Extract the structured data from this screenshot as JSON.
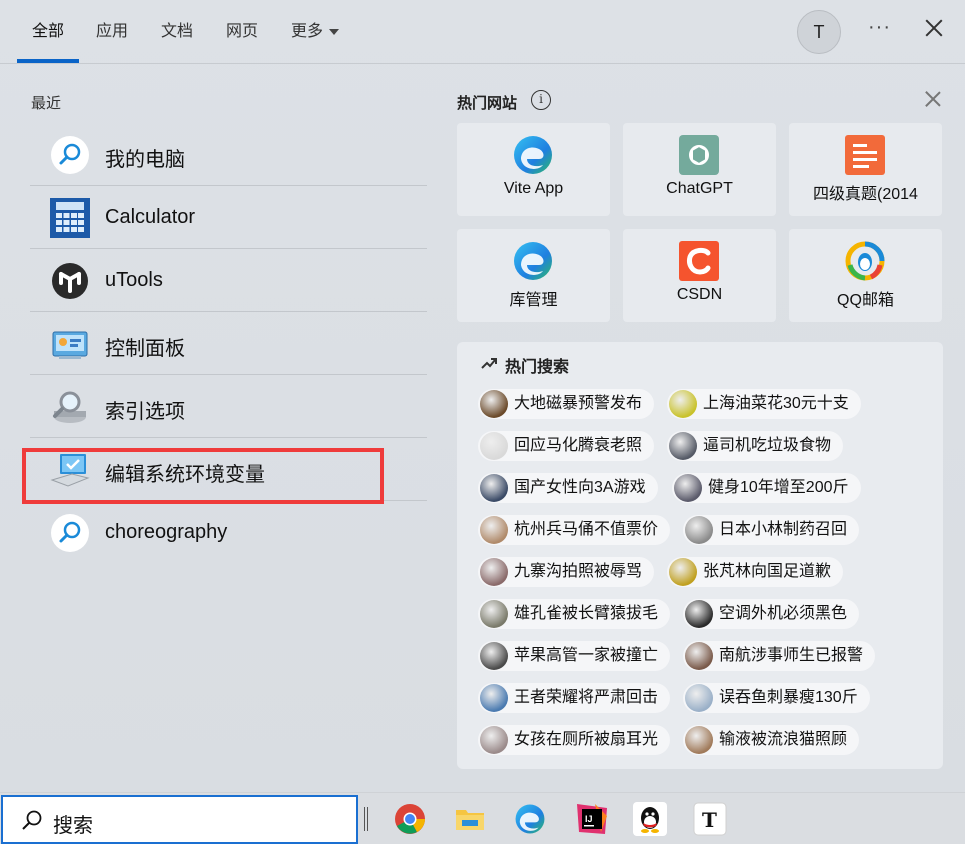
{
  "tabs": [
    {
      "label": "全部",
      "active": true
    },
    {
      "label": "应用",
      "active": false
    },
    {
      "label": "文档",
      "active": false
    },
    {
      "label": "网页",
      "active": false
    },
    {
      "label": "更多",
      "active": false
    }
  ],
  "avatar_letter": "T",
  "more_dots": "···",
  "recent": {
    "title": "最近",
    "items": [
      {
        "label": "我的电脑",
        "icon": "search-icon"
      },
      {
        "label": "Calculator",
        "icon": "calculator-icon"
      },
      {
        "label": "uTools",
        "icon": "utools-icon"
      },
      {
        "label": "控制面板",
        "icon": "control-panel-icon"
      },
      {
        "label": "索引选项",
        "icon": "indexing-options-icon"
      },
      {
        "label": "编辑系统环境变量",
        "icon": "system-properties-icon"
      },
      {
        "label": "choreography",
        "icon": "search-icon"
      }
    ]
  },
  "hot_sites": {
    "title": "热门网站",
    "sites": [
      {
        "label": "Vite App",
        "icon": "edge-icon"
      },
      {
        "label": "ChatGPT",
        "icon": "chatgpt-icon"
      },
      {
        "label": "四级真题(2014",
        "icon": "document-icon"
      },
      {
        "label": "库管理",
        "icon": "edge-icon"
      },
      {
        "label": "CSDN",
        "icon": "csdn-icon"
      },
      {
        "label": "QQ邮箱",
        "icon": "qqmail-icon"
      }
    ]
  },
  "hot_search": {
    "title": "热门搜索",
    "items": [
      {
        "text": "大地磁暴预警发布",
        "color": "#6b4a2a"
      },
      {
        "text": "上海油菜花30元十支",
        "color": "#c9c22a"
      },
      {
        "text": "回应马化腾衰老照",
        "color": "#d9d9d9"
      },
      {
        "text": "逼司机吃垃圾食物",
        "color": "#555a66"
      },
      {
        "text": "国产女性向3A游戏",
        "color": "#3a4a66"
      },
      {
        "text": "健身10年增至200斤",
        "color": "#5a5a6a"
      },
      {
        "text": "杭州兵马俑不值票价",
        "color": "#b08a6a"
      },
      {
        "text": "日本小林制药召回",
        "color": "#8a8a8a"
      },
      {
        "text": "九寨沟拍照被辱骂",
        "color": "#8a6a6a"
      },
      {
        "text": "张芃林向国足道歉",
        "color": "#c0a020"
      },
      {
        "text": "雄孔雀被长臂猿拔毛",
        "color": "#7a7a6a"
      },
      {
        "text": "空调外机必须黑色",
        "color": "#2a2a2a"
      },
      {
        "text": "苹果高管一家被撞亡",
        "color": "#4a4a4a"
      },
      {
        "text": "南航涉事师生已报警",
        "color": "#7a5a4a"
      },
      {
        "text": "王者荣耀将严肃回击",
        "color": "#4a7ab0"
      },
      {
        "text": "误吞鱼刺暴瘦130斤",
        "color": "#9ab0c8"
      },
      {
        "text": "女孩在厕所被扇耳光",
        "color": "#9a8a8a"
      },
      {
        "text": "输液被流浪猫照顾",
        "color": "#a07a5a"
      }
    ]
  },
  "taskbar": {
    "search_label": "搜索",
    "apps": [
      "chrome-icon",
      "file-explorer-icon",
      "edge-icon",
      "jetbrains-icon",
      "qq-icon",
      "typora-icon"
    ]
  },
  "colors": {
    "accent": "#0a64c8",
    "highlight": "#ef3b3b"
  }
}
